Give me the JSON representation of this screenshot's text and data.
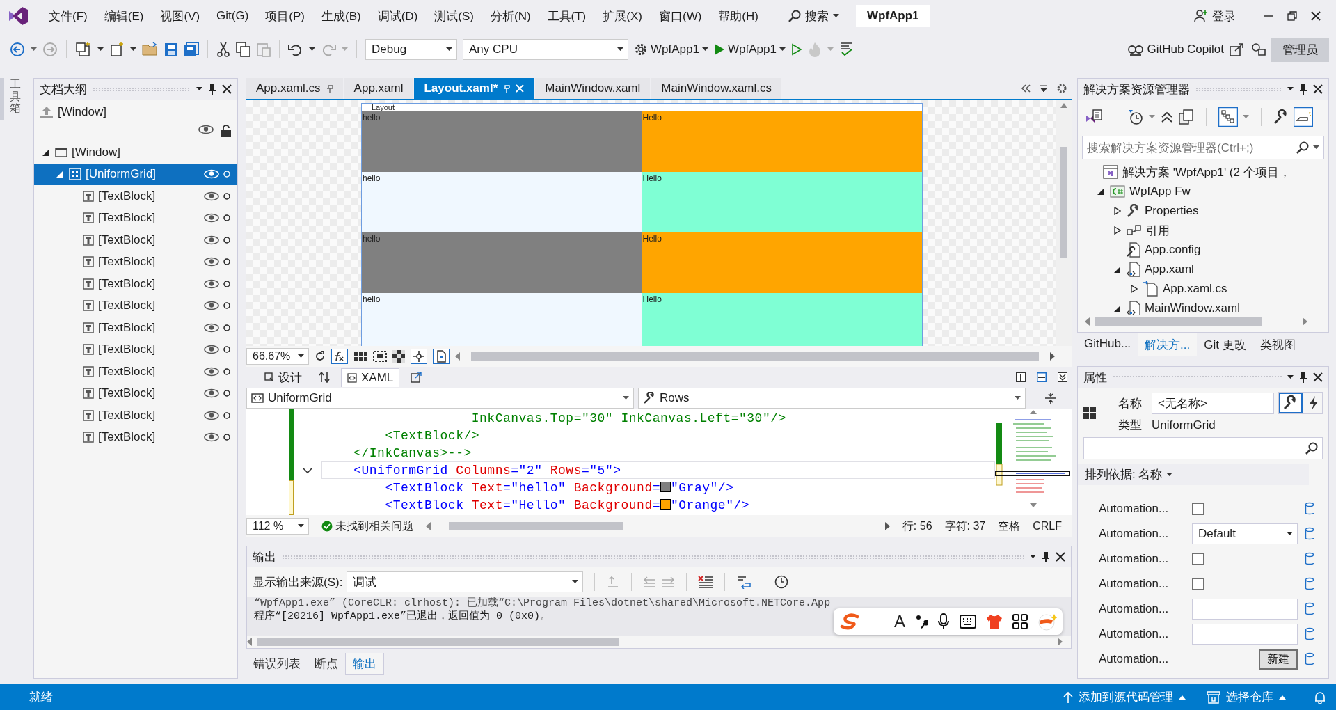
{
  "title_bar": {
    "menu": [
      "文件(F)",
      "编辑(E)",
      "视图(V)",
      "Git(G)",
      "项目(P)",
      "生成(B)",
      "调试(D)",
      "测试(S)",
      "分析(N)",
      "工具(T)",
      "扩展(X)",
      "窗口(W)",
      "帮助(H)"
    ],
    "search": "搜索",
    "title": "WpfApp1",
    "sign_in": "登录"
  },
  "toolbar": {
    "configuration": "Debug",
    "platform": "Any CPU",
    "startup_project": "WpfApp1",
    "run_target": "WpfApp1",
    "copilot": "GitHub Copilot",
    "admin": "管理员"
  },
  "tool_strip": {
    "label": "工具箱"
  },
  "document_outline": {
    "title": "文档大纲",
    "root": "[Window]",
    "tree": [
      {
        "label": "[Window]",
        "kind": "window",
        "expanded": true,
        "selected": false,
        "children": [
          {
            "label": "[UniformGrid]",
            "kind": "grid",
            "expanded": true,
            "selected": true,
            "children": [
              {
                "label": "[TextBlock]",
                "kind": "text",
                "selected": false
              },
              {
                "label": "[TextBlock]",
                "kind": "text",
                "selected": false
              },
              {
                "label": "[TextBlock]",
                "kind": "text",
                "selected": false
              },
              {
                "label": "[TextBlock]",
                "kind": "text",
                "selected": false
              },
              {
                "label": "[TextBlock]",
                "kind": "text",
                "selected": false
              },
              {
                "label": "[TextBlock]",
                "kind": "text",
                "selected": false
              },
              {
                "label": "[TextBlock]",
                "kind": "text",
                "selected": false
              },
              {
                "label": "[TextBlock]",
                "kind": "text",
                "selected": false
              },
              {
                "label": "[TextBlock]",
                "kind": "text",
                "selected": false
              },
              {
                "label": "[TextBlock]",
                "kind": "text",
                "selected": false
              },
              {
                "label": "[TextBlock]",
                "kind": "text",
                "selected": false
              },
              {
                "label": "[TextBlock]",
                "kind": "text",
                "selected": false
              }
            ]
          }
        ]
      }
    ]
  },
  "doc_tabs": [
    {
      "label": "App.xaml.cs",
      "selected": false,
      "pinned": true
    },
    {
      "label": "App.xaml",
      "selected": false,
      "pinned": false
    },
    {
      "label": "Layout.xaml*",
      "selected": true,
      "pinned": true
    },
    {
      "label": "MainWindow.xaml",
      "selected": false,
      "pinned": false
    },
    {
      "label": "MainWindow.xaml.cs",
      "selected": false,
      "pinned": false
    }
  ],
  "designer": {
    "window_label": "Layout",
    "cells": [
      {
        "text": "hello",
        "color": "#808080"
      },
      {
        "text": "Hello",
        "color": "#ffa500"
      },
      {
        "text": "hello",
        "color": "#f0f8ff"
      },
      {
        "text": "Hello",
        "color": "#7fffd4"
      },
      {
        "text": "hello",
        "color": "#808080"
      },
      {
        "text": "Hello",
        "color": "#ffa500"
      },
      {
        "text": "hello",
        "color": "#f0f8ff"
      },
      {
        "text": "Hello",
        "color": "#7fffd4"
      }
    ]
  },
  "zoom_bar": {
    "zoom": "66.67%"
  },
  "view_tabs": [
    {
      "label": "设计",
      "selected": false
    },
    {
      "label": "XAML",
      "selected": true
    }
  ],
  "selectors": {
    "element": "UniformGrid",
    "property": "Rows"
  },
  "code": {
    "lines": [
      {
        "tokens": [
          {
            "kind": "comment",
            "text": "                   InkCanvas.Top=\"30\" InkCanvas.Left=\"30\"/>"
          }
        ]
      },
      {
        "tokens": [
          {
            "kind": "comment",
            "text": "        <TextBlock/>"
          }
        ]
      },
      {
        "tokens": [
          {
            "kind": "comment",
            "text": "    </InkCanvas>-->"
          }
        ]
      },
      {
        "current": true,
        "tokens": [
          {
            "kind": "tag",
            "text": "    <UniformGrid"
          },
          {
            "kind": "attr",
            "text": " Columns"
          },
          {
            "kind": "tag",
            "text": "=\"2\""
          },
          {
            "kind": "attr",
            "text": " Rows"
          },
          {
            "kind": "tag",
            "text": "=\"5\">"
          }
        ]
      },
      {
        "tokens": [
          {
            "kind": "tag",
            "text": "        <TextBlock"
          },
          {
            "kind": "attr",
            "text": " Text"
          },
          {
            "kind": "tag",
            "text": "=\"hello\""
          },
          {
            "kind": "attr",
            "text": " Background"
          },
          {
            "kind": "tag",
            "text": "="
          },
          {
            "kind": "swatch",
            "color": "#808080"
          },
          {
            "kind": "tag",
            "text": "\"Gray\"/>"
          }
        ]
      },
      {
        "tokens": [
          {
            "kind": "tag",
            "text": "        <TextBlock"
          },
          {
            "kind": "attr",
            "text": " Text"
          },
          {
            "kind": "tag",
            "text": "=\"Hello\""
          },
          {
            "kind": "attr",
            "text": " Background"
          },
          {
            "kind": "tag",
            "text": "="
          },
          {
            "kind": "swatch",
            "color": "#ffa500"
          },
          {
            "kind": "tag",
            "text": "\"Orange\"/>"
          }
        ]
      }
    ]
  },
  "code_status": {
    "zoom": "112 %",
    "issues": "未找到相关问题",
    "line": "行: 56",
    "char": "字符: 37",
    "whitespace": "空格",
    "line_ending": "CRLF"
  },
  "output": {
    "title": "输出",
    "source_label": "显示输出来源(S):",
    "source": "调试",
    "lines": [
      "“WpfApp1.exe” (CoreCLR: clrhost): 已加载“C:\\Program Files\\dotnet\\shared\\Microsoft.NETCore.App",
      "程序“[20216] WpfApp1.exe”已退出，返回值为 0 (0x0)。"
    ]
  },
  "bottom_tabs": [
    {
      "label": "错误列表",
      "selected": false
    },
    {
      "label": "断点",
      "selected": false
    },
    {
      "label": "输出",
      "selected": true
    }
  ],
  "solution_explorer": {
    "title": "解决方案资源管理器",
    "search_placeholder": "搜索解决方案资源管理器(Ctrl+;)",
    "tree": [
      {
        "label": "解决方案 'WpfApp1' (2 个项目，",
        "kind": "solution",
        "children": [
          {
            "label": "WpfApp Fw",
            "kind": "csproj",
            "expanded": true,
            "children": [
              {
                "label": "Properties",
                "kind": "wrench",
                "expanded": false
              },
              {
                "label": "引用",
                "kind": "refs",
                "expanded": false
              },
              {
                "label": "App.config",
                "kind": "config"
              },
              {
                "label": "App.xaml",
                "kind": "xaml",
                "expanded": true,
                "children": [
                  {
                    "label": "App.xaml.cs",
                    "kind": "cs",
                    "expanded": false
                  }
                ]
              },
              {
                "label": "MainWindow.xaml",
                "kind": "xaml",
                "expanded": true
              }
            ]
          }
        ]
      }
    ]
  },
  "right_tabs": [
    {
      "label": "GitHub...",
      "selected": false
    },
    {
      "label": "解决方...",
      "selected": true
    },
    {
      "label": "Git 更改",
      "selected": false
    },
    {
      "label": "类视图",
      "selected": false
    }
  ],
  "properties": {
    "title": "属性",
    "name_label": "名称",
    "name_value": "<无名称>",
    "type_label": "类型",
    "type_value": "UniformGrid",
    "sort": "排列依据: 名称",
    "rows": [
      {
        "label": "Automation...",
        "kind": "checkbox",
        "checked": false
      },
      {
        "label": "Automation...",
        "kind": "dropdown",
        "value": "Default"
      },
      {
        "label": "Automation...",
        "kind": "checkbox",
        "checked": false
      },
      {
        "label": "Automation...",
        "kind": "checkbox",
        "checked": false
      },
      {
        "label": "Automation...",
        "kind": "text"
      },
      {
        "label": "Automation...",
        "kind": "text"
      },
      {
        "label": "Automation...",
        "kind": "button",
        "button": "新建"
      }
    ]
  },
  "ime_toolbar": {
    "font_button": "A"
  },
  "status_bar": {
    "ready": "就绪",
    "source_control": "添加到源代码管理",
    "repository": "选择仓库"
  }
}
